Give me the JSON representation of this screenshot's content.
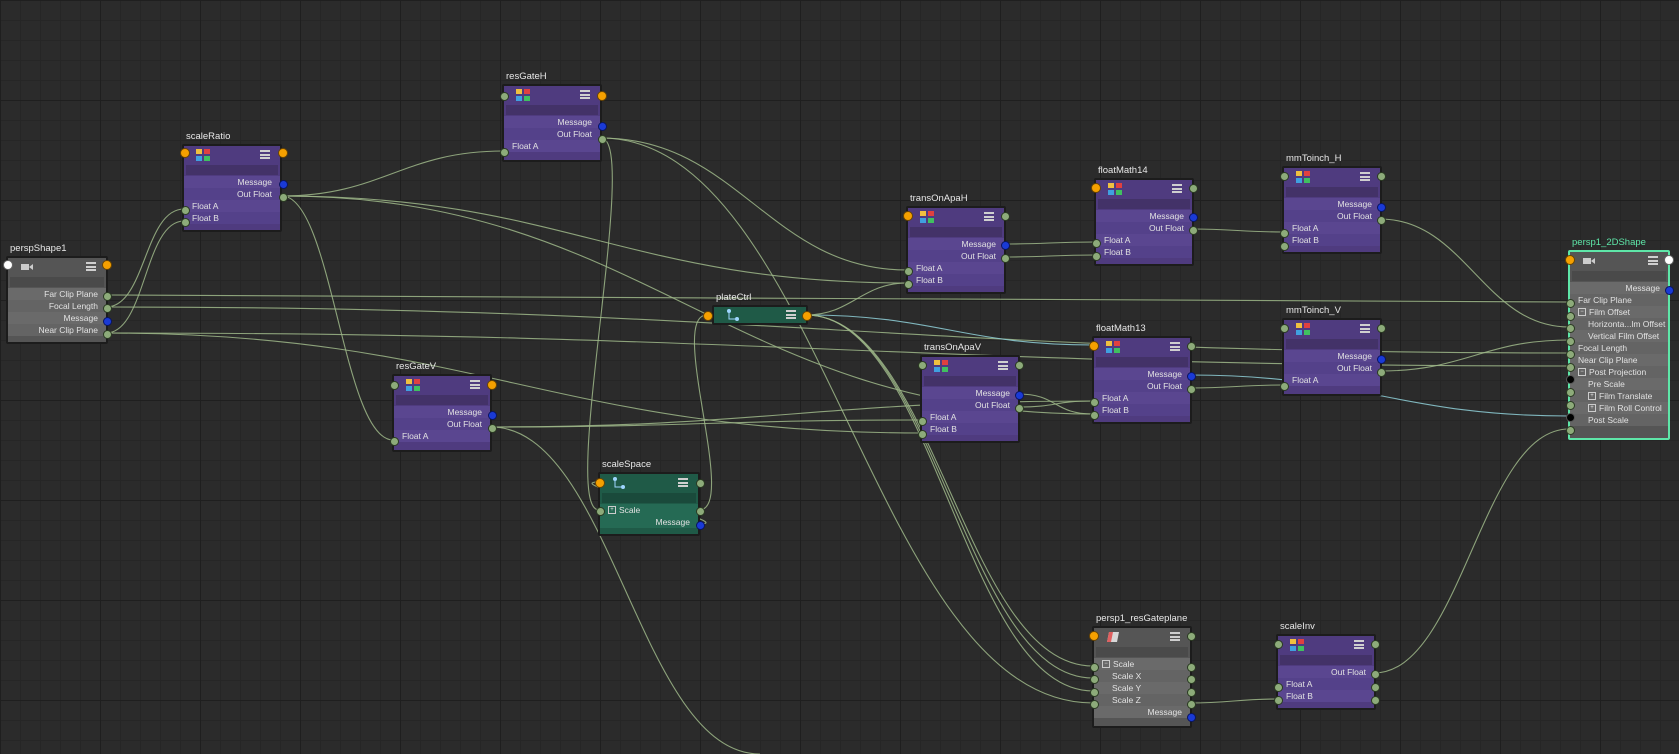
{
  "nodes": {
    "perspShape1": {
      "title": "perspShape1",
      "icon": "camera-icon",
      "rows": [
        "Far Clip Plane",
        "Focal Length",
        "Message",
        "Near Clip Plane"
      ]
    },
    "scaleRatio": {
      "title": "scaleRatio",
      "icon": "float-math-icon",
      "rows": [
        "Message",
        "Out Float",
        "Float A",
        "Float B"
      ]
    },
    "resGateH": {
      "title": "resGateH",
      "icon": "float-math-icon",
      "rows": [
        "Message",
        "Out Float",
        "Float A"
      ]
    },
    "resGateV": {
      "title": "resGateV",
      "icon": "float-math-icon",
      "rows": [
        "Message",
        "Out Float",
        "Float A"
      ]
    },
    "scaleSpace": {
      "title": "scaleSpace",
      "icon": "transform-icon",
      "rows": [
        "Scale",
        "Message"
      ]
    },
    "plateCtrl": {
      "title": "plateCtrl",
      "icon": "transform-icon"
    },
    "transOnApaH": {
      "title": "transOnApaH",
      "icon": "float-math-icon",
      "rows": [
        "Message",
        "Out Float",
        "Float A",
        "Float B"
      ]
    },
    "transOnApaV": {
      "title": "transOnApaV",
      "icon": "float-math-icon",
      "rows": [
        "Message",
        "Out Float",
        "Float A",
        "Float B"
      ]
    },
    "floatMath14": {
      "title": "floatMath14",
      "icon": "float-math-icon",
      "rows": [
        "Message",
        "Out Float",
        "Float A",
        "Float B"
      ]
    },
    "floatMath13": {
      "title": "floatMath13",
      "icon": "float-math-icon",
      "rows": [
        "Message",
        "Out Float",
        "Float A",
        "Float B"
      ]
    },
    "mmToinch_H": {
      "title": "mmToinch_H",
      "icon": "float-math-icon",
      "rows": [
        "Message",
        "Out Float",
        "Float A",
        "Float B"
      ]
    },
    "mmToinch_V": {
      "title": "mmToinch_V",
      "icon": "float-math-icon",
      "rows": [
        "Message",
        "Out Float",
        "Float A"
      ]
    },
    "persp1_resGateplane": {
      "title": "persp1_resGateplane",
      "icon": "plane-icon",
      "rows": [
        "Scale",
        "Scale X",
        "Scale Y",
        "Scale Z",
        "Message"
      ]
    },
    "scaleInv": {
      "title": "scaleInv",
      "icon": "float-math-icon",
      "rows": [
        "Out Float",
        "Float A",
        "Float B"
      ]
    },
    "persp1_2DShape": {
      "title": "persp1_2DShape",
      "icon": "camera-icon",
      "rows": [
        "Message",
        "Far Clip Plane",
        "Film Offset",
        "Horizonta...lm Offset",
        "Vertical Film Offset",
        "Focal Length",
        "Near Clip Plane",
        "Post Projection",
        "Pre Scale",
        "Film Translate",
        "Film Roll Control",
        "Post Scale"
      ]
    }
  },
  "colors": {
    "wire": "#9fb88a",
    "wire_selected": "#8fd0d8",
    "node_purple": "#4f3b7f",
    "node_green": "#1f5a47",
    "node_grey": "#555555",
    "selection": "#5ee6a8"
  }
}
